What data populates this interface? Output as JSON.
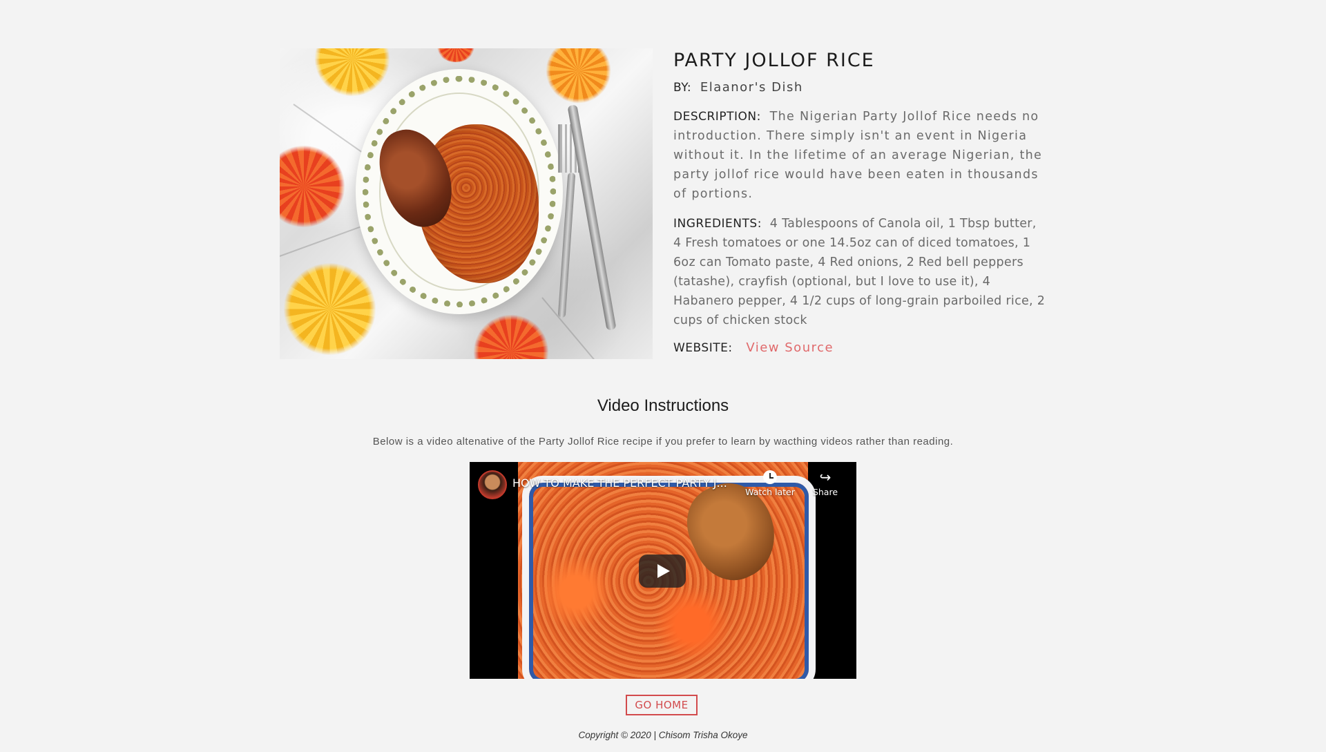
{
  "recipe": {
    "title": "PARTY JOLLOF RICE",
    "by_label": "BY:",
    "by_value": "Elaanor's Dish",
    "description_label": "DESCRIPTION:",
    "description": "The Nigerian Party Jollof Rice needs no introduction. There simply isn't an event in Nigeria without it. In the lifetime of an average Nigerian, the party jollof rice would have been eaten in thousands of portions.",
    "ingredients_label": "INGREDIENTS:",
    "ingredients": "4 Tablespoons of Canola oil, 1 Tbsp butter, 4 Fresh tomatoes or one 14.5oz can of diced tomatoes, 1 6oz can Tomato paste, 4 Red onions, 2 Red bell peppers (tatashe), crayfish (optional, but I love to use it), 4 Habanero pepper, 4 1/2 cups of long-grain parboiled rice, 2 cups of chicken stock",
    "website_label": "WEBSITE:",
    "website_link": "View Source"
  },
  "video_section": {
    "heading": "Video Instructions",
    "subtext": "Below is a video altenative of the Party Jollof Rice recipe if you prefer to learn by wacthing videos rather than reading.",
    "video_title": "HOW TO MAKE THE PERFECT PARTY J...",
    "watch_later_label": "Watch later",
    "share_label": "Share",
    "share_icon": "↪"
  },
  "footer": {
    "go_home_label": "GO HOME",
    "copyright": "Copyright © 2020 | Chisom Trisha Okoye"
  },
  "colors": {
    "background": "#f3f3f3",
    "accent_link": "#e0696b",
    "button_border": "#d24a4c"
  }
}
